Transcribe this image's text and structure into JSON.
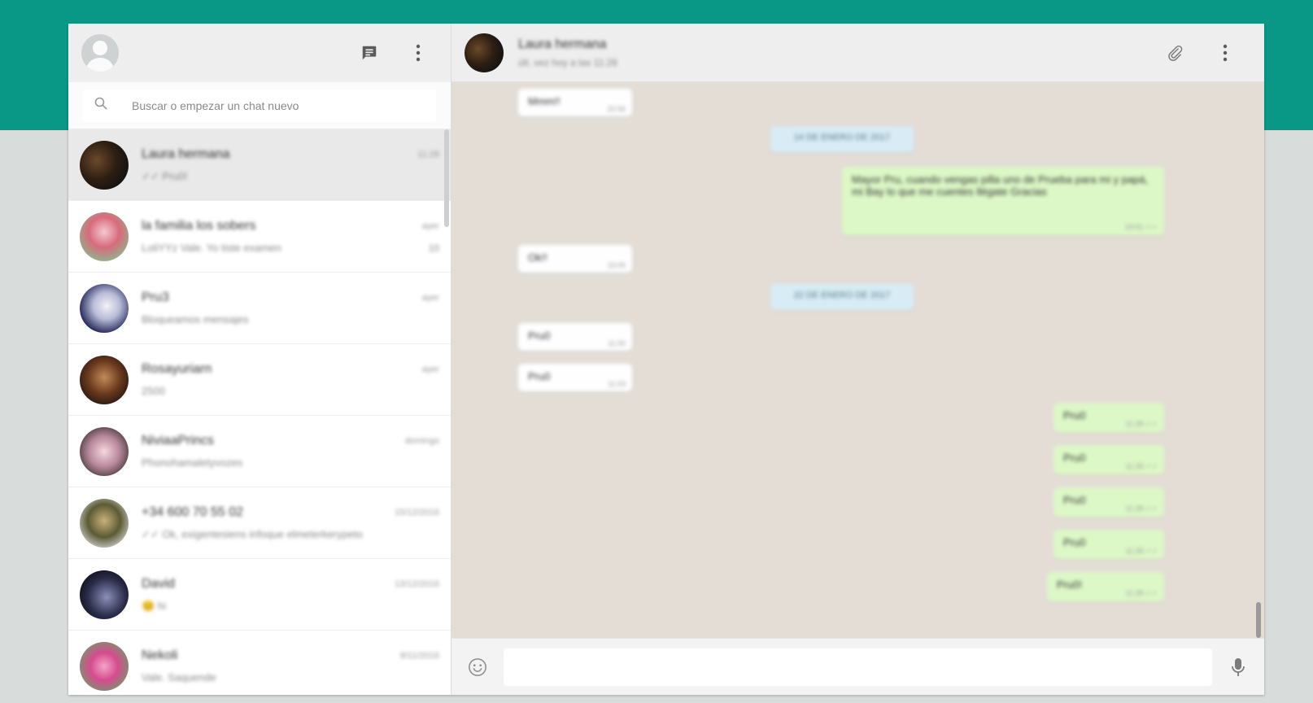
{
  "colors": {
    "brand_band": "#0a9886",
    "outgoing_bubble": "#dcf8c6",
    "incoming_bubble": "#fefefe",
    "chat_background": "#e3ddd6"
  },
  "left_header": {
    "new_chat_icon": "message-icon",
    "menu_icon": "more-vertical-icon"
  },
  "search": {
    "placeholder": "Buscar o empezar un chat nuevo"
  },
  "chats": [
    {
      "name": "Laura hermana",
      "time": "11:28",
      "preview": "✓✓ Pru0!",
      "unread": ""
    },
    {
      "name": "la familia los sobers",
      "time": "ayer",
      "preview": "LoliYYz Vale. Yo tiste examen",
      "unread": "10"
    },
    {
      "name": "Pru3",
      "time": "ayer",
      "preview": "Bloqueamos mensajes",
      "unread": ""
    },
    {
      "name": "Rosayuriarn",
      "time": "ayer",
      "preview": "2500",
      "unread": ""
    },
    {
      "name": "NiviaaPrincs",
      "time": "domingo",
      "preview": "Phonohamaletyvozes",
      "unread": ""
    },
    {
      "name": "+34 600 70 55 02",
      "time": "15/12/2016",
      "preview": "✓✓ Ok, exigentesiens infoque elmeterkerypeto",
      "unread": ""
    },
    {
      "name": "David",
      "time": "13/12/2016",
      "preview": "😊 hi",
      "unread": ""
    },
    {
      "name": "Nekoli",
      "time": "8/11/2016",
      "preview": "Vale. Saquende",
      "unread": ""
    }
  ],
  "chat_header": {
    "name": "Laura hermana",
    "status": "últ. vez hoy a las 11:28",
    "attach_icon": "paperclip-icon",
    "menu_icon": "more-vertical-icon"
  },
  "messages": [
    {
      "kind": "in",
      "text": "Mmm!!",
      "time": "20:56"
    },
    {
      "kind": "date",
      "text": "14 DE ENERO DE 2017"
    },
    {
      "kind": "out",
      "text": "Mayor Pru, cuando vengas pilla uno de Prueba para mi y papá, mi Bay lo que me cuentes llégate Gracias",
      "time": "19:01 ✓✓"
    },
    {
      "kind": "in",
      "text": "Ok!!",
      "time": "19:05"
    },
    {
      "kind": "date",
      "text": "22 DE ENERO DE 2017"
    },
    {
      "kind": "in",
      "text": "Pru0",
      "time": "11:00"
    },
    {
      "kind": "in",
      "text": "Pru0",
      "time": "11:03"
    },
    {
      "kind": "out",
      "text": "Pru0",
      "time": "11:28 ✓✓"
    },
    {
      "kind": "out",
      "text": "Pru0",
      "time": "11:28 ✓✓"
    },
    {
      "kind": "out",
      "text": "Pru0",
      "time": "11:28 ✓✓"
    },
    {
      "kind": "out",
      "text": "Pru0",
      "time": "11:28 ✓✓"
    },
    {
      "kind": "out",
      "text": "Pru0!",
      "time": "11:28 ✓✓"
    }
  ],
  "composer": {
    "emoji_icon": "emoji-icon",
    "placeholder": "",
    "mic_icon": "microphone-icon"
  }
}
